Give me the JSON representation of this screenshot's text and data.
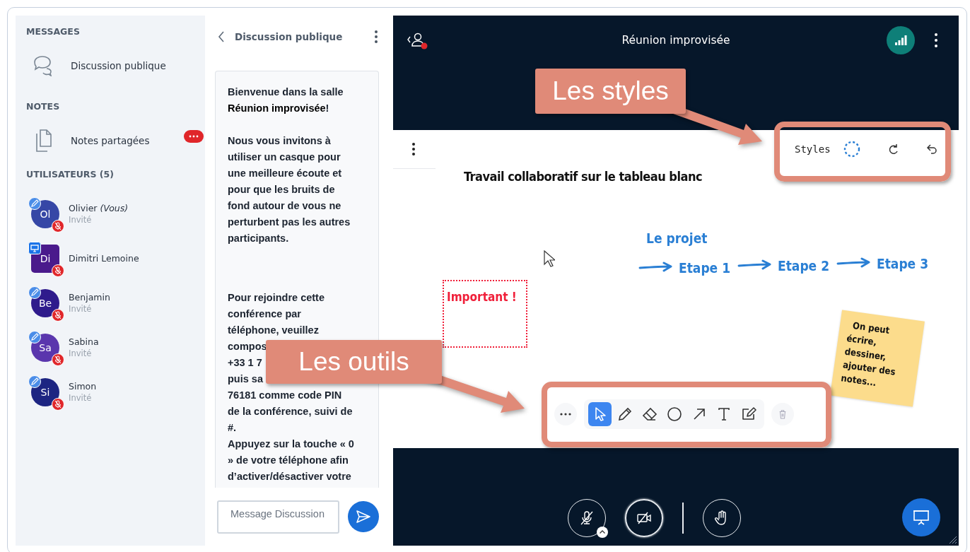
{
  "sidebar": {
    "sections": [
      {
        "heading": "MESSAGES",
        "items": [
          {
            "kind": "chat",
            "label": "Discussion publique",
            "badge": false
          }
        ]
      },
      {
        "heading": "NOTES",
        "items": [
          {
            "kind": "notes",
            "label": "Notes partagées",
            "badge": true
          }
        ]
      }
    ],
    "users_heading": "UTILISATEURS (5)",
    "users": [
      {
        "initials": "Ol",
        "name": "Olivier *(Vous)*",
        "role": "Invité",
        "kind": "viewer",
        "color": "#3647a6",
        "muted": true
      },
      {
        "initials": "Di",
        "name": "Dimitri Lemoine",
        "kind": "presenter",
        "color": "#4a1a8c",
        "muted": true
      },
      {
        "initials": "Be",
        "name": "Benjamin",
        "role": "Invité",
        "kind": "viewer",
        "color": "#2f1b8c",
        "muted": true
      },
      {
        "initials": "Sa",
        "name": "Sabina",
        "role": "Invité",
        "kind": "viewer",
        "color": "#5a36ad",
        "muted": true
      },
      {
        "initials": "Si",
        "name": "Simon",
        "role": "Invité",
        "kind": "viewer",
        "color": "#1d2582",
        "muted": true
      }
    ]
  },
  "chat": {
    "title": "Discussion publique",
    "paragraphs": [
      {
        "lines": [
          "Bienvenue dans la salle",
          "**Réunion improvisée**!"
        ]
      },
      {
        "lines": [
          "Nous vous invitons à",
          "utiliser un casque pour",
          "une meilleure écoute et",
          "pour que les bruits de",
          "fond autour de vous ne",
          "perturbent pas les autres",
          "participants."
        ]
      },
      {
        "lines": [
          "Pour rejoindre cette",
          "conférence par",
          "téléphone, veuillez",
          "compos",
          "+33 1 7",
          "puis sa",
          "76181 comme code PIN",
          "de la conférence, suivi de",
          "#.",
          "Appuyez sur la touche « 0",
          "» de votre téléphone afin",
          "d’activer/désactiver votre"
        ]
      }
    ],
    "input": {
      "placeholder": "Message Discussion"
    }
  },
  "meeting": {
    "title": "Réunion improvisée",
    "mic": {
      "muted": true
    },
    "camera": {
      "on": false
    }
  },
  "whiteboard": {
    "title": "Travail collaboratif sur le tableau blanc",
    "heading": "Le projet",
    "steps": [
      "Etape 1",
      "Etape 2",
      "Etape 3"
    ],
    "important": "Important !",
    "sticky_note": [
      "On peut",
      "écrire,",
      "dessiner,",
      "ajouter des",
      "notes..."
    ],
    "styles_label": "Styles",
    "tools": [
      {
        "kind": "select",
        "selected": true
      },
      {
        "kind": "pencil",
        "selected": false
      },
      {
        "kind": "eraser",
        "selected": false
      },
      {
        "kind": "circle",
        "selected": false
      },
      {
        "kind": "arrow",
        "selected": false
      },
      {
        "kind": "text",
        "selected": false
      },
      {
        "kind": "note",
        "selected": false
      }
    ]
  },
  "annotations": [
    {
      "kind": "styles",
      "label": "Les styles"
    },
    {
      "kind": "tools",
      "label": "Les outils"
    }
  ]
}
